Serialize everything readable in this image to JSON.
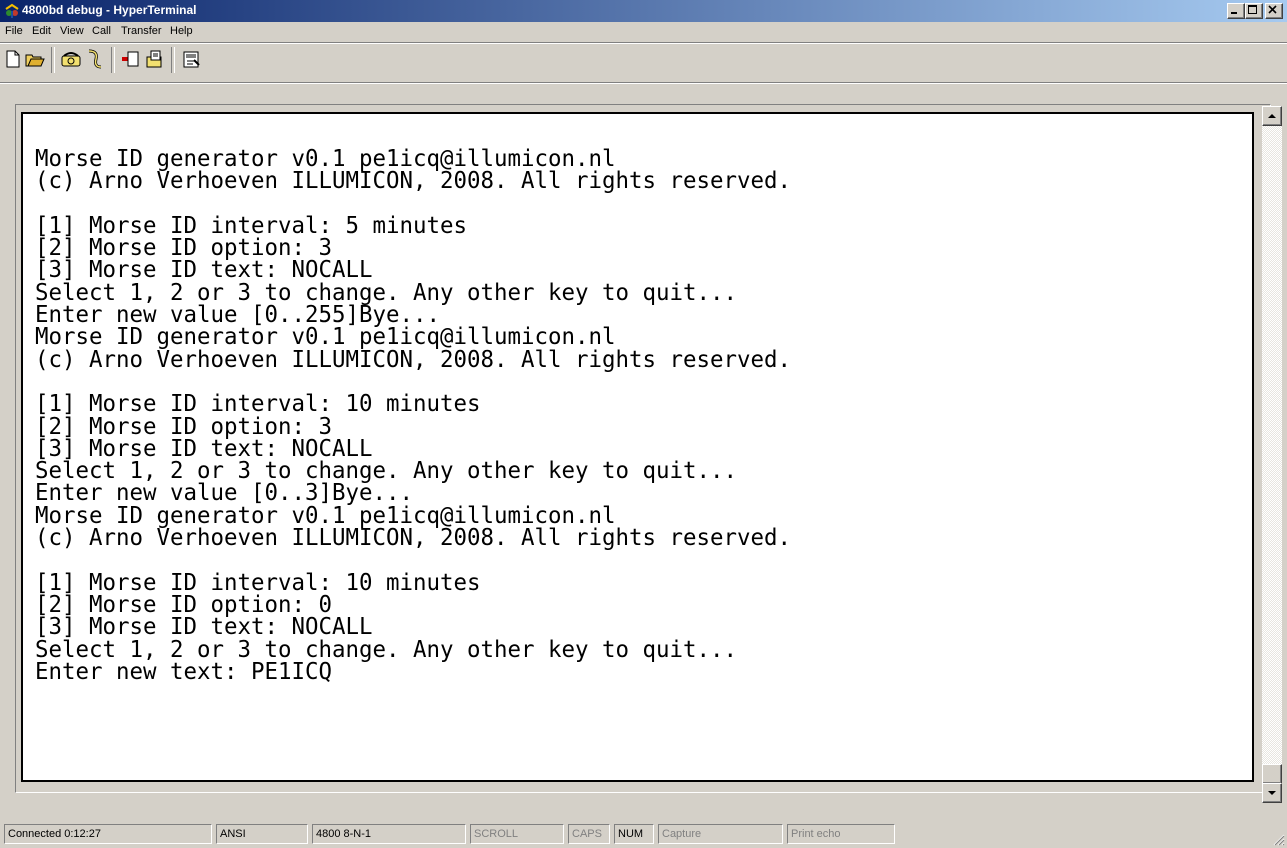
{
  "window": {
    "title": "4800bd debug - HyperTerminal",
    "title_gradient": [
      "#0a246a",
      "#a6caf0"
    ]
  },
  "menu": [
    "File",
    "Edit",
    "View",
    "Call",
    "Transfer",
    "Help"
  ],
  "toolbar": {
    "buttons": [
      "new-icon",
      "open-icon",
      "call-icon",
      "disconnect-icon",
      "send-icon",
      "receive-icon",
      "properties-icon"
    ]
  },
  "terminal": {
    "lines": [
      "Morse ID generator v0.1 pe1icq@illumicon.nl",
      "(c) Arno Verhoeven ILLUMICON, 2008. All rights reserved.",
      "",
      "[1] Morse ID interval: 5 minutes",
      "[2] Morse ID option: 3",
      "[3] Morse ID text: NOCALL",
      "Select 1, 2 or 3 to change. Any other key to quit...",
      "Enter new value [0..255]Bye...",
      "Morse ID generator v0.1 pe1icq@illumicon.nl",
      "(c) Arno Verhoeven ILLUMICON, 2008. All rights reserved.",
      "",
      "[1] Morse ID interval: 10 minutes",
      "[2] Morse ID option: 3",
      "[3] Morse ID text: NOCALL",
      "Select 1, 2 or 3 to change. Any other key to quit...",
      "Enter new value [0..3]Bye...",
      "Morse ID generator v0.1 pe1icq@illumicon.nl",
      "(c) Arno Verhoeven ILLUMICON, 2008. All rights reserved.",
      "",
      "[1] Morse ID interval: 10 minutes",
      "[2] Morse ID option: 0",
      "[3] Morse ID text: NOCALL",
      "Select 1, 2 or 3 to change. Any other key to quit...",
      "Enter new text: PE1ICQ"
    ]
  },
  "status": {
    "connected": "Connected 0:12:27",
    "emulation": "ANSI",
    "settings": "4800 8-N-1",
    "scroll": "SCROLL",
    "caps": "CAPS",
    "num": "NUM",
    "capture": "Capture",
    "print_echo": "Print echo"
  }
}
